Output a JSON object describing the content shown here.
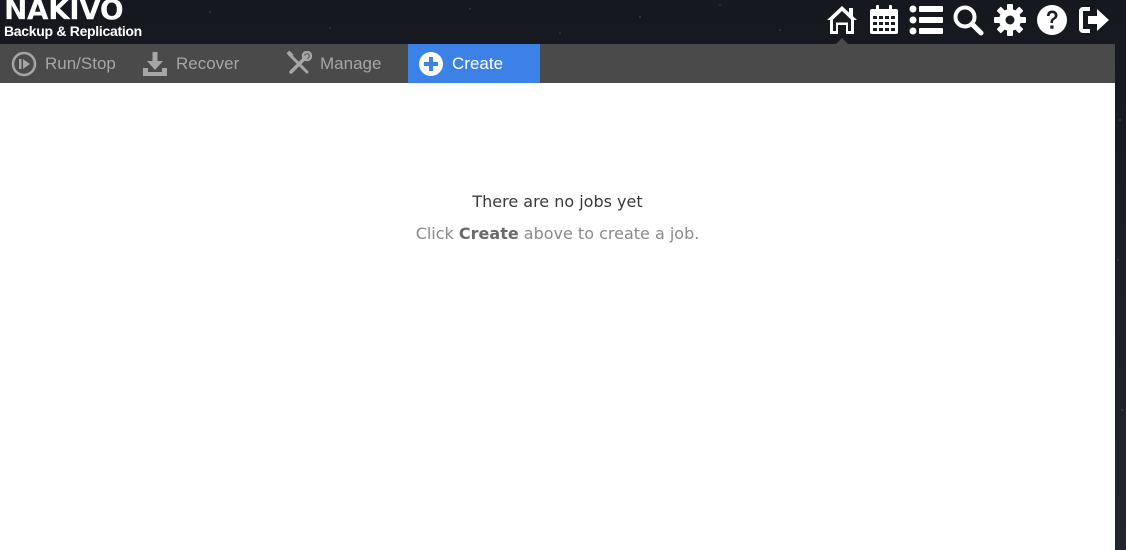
{
  "header": {
    "logo_main": "NAKIVO",
    "logo_sub": "Backup & Replication",
    "icons": [
      "home-icon",
      "calendar-icon",
      "list-icon",
      "search-icon",
      "gear-icon",
      "help-icon",
      "logout-icon"
    ],
    "active_icon": "home-icon"
  },
  "toolbar": {
    "run_stop": "Run/Stop",
    "recover": "Recover",
    "manage": "Manage",
    "create": "Create",
    "active": "Create",
    "active_color": "#3c82e6"
  },
  "main": {
    "empty_title": "There are no jobs yet",
    "hint_before": "Click ",
    "hint_strong": "Create",
    "hint_after": " above to create a job."
  }
}
